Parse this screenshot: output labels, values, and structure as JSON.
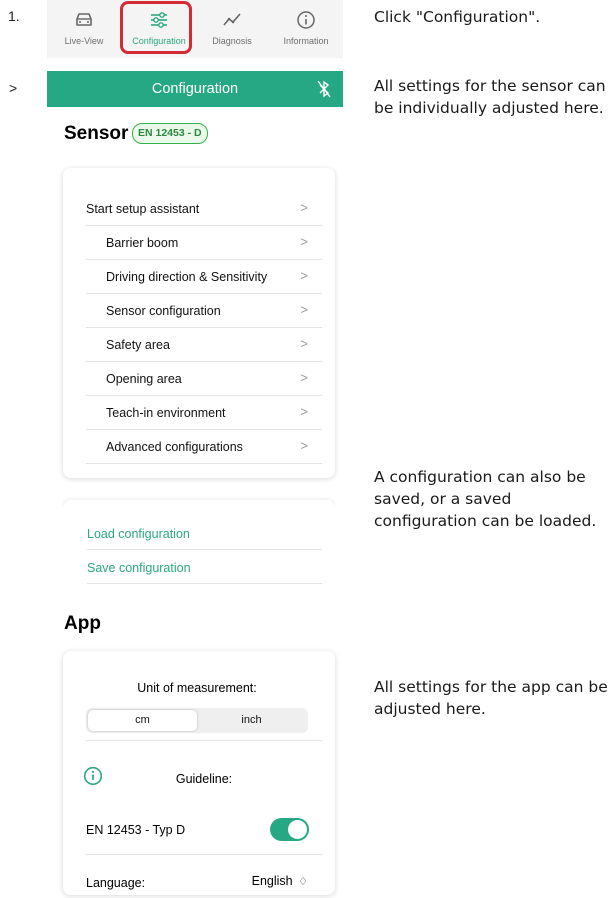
{
  "steps": {
    "step1": "1.",
    "step2": ">"
  },
  "tabbar": {
    "tabs": [
      {
        "label": "Live-View",
        "icon": "car-icon"
      },
      {
        "label": "Configuration",
        "icon": "sliders-icon",
        "active": true
      },
      {
        "label": "Diagnosis",
        "icon": "chart-line-icon"
      },
      {
        "label": "Information",
        "icon": "info-icon"
      }
    ]
  },
  "header": {
    "title": "Configuration",
    "icon": "bluetooth-off-icon"
  },
  "sensor": {
    "title": "Sensor",
    "badge": "EN 12453 - D",
    "menu": [
      "Start setup assistant",
      "Barrier boom",
      "Driving direction & Sensitivity",
      "Sensor configuration",
      "Safety area",
      "Opening area",
      "Teach-in environment",
      "Advanced configurations"
    ],
    "chevron": ">",
    "links": [
      "Load configuration",
      "Save configuration"
    ]
  },
  "app": {
    "title": "App",
    "unit_label": "Unit of measurement:",
    "unit_options": [
      "cm",
      "inch"
    ],
    "unit_selected": "cm",
    "guideline_label": "Guideline:",
    "guideline_value": "EN 12453 - Typ D",
    "guideline_enabled": true,
    "language_label": "Language:",
    "language_value": "English",
    "language_arrows": "♢"
  },
  "notes": {
    "n1": "Click \"Configuration\".",
    "n2": "All settings for the sensor can be individually adjusted here.",
    "n3": "A configuration can also be saved, or a saved configuration can be loaded.",
    "n4": "All settings for the app can be adjusted here."
  },
  "colors": {
    "accent": "#26a884",
    "highlight": "#d42a35",
    "badge_border": "#35b34a"
  }
}
